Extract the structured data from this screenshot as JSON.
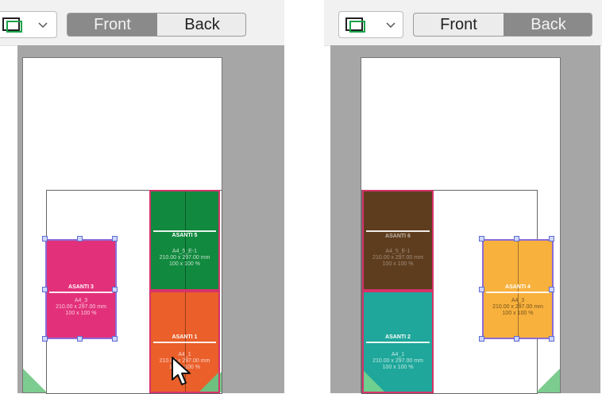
{
  "left": {
    "tabs": {
      "front": "Front",
      "back": "Back",
      "active": "front"
    },
    "blocks": [
      {
        "name": "ASANTI 3",
        "info1": "A4_3",
        "info2": "210.00 x 297.00 mm",
        "info3": "100 x 100 %",
        "color": "#e3307a"
      },
      {
        "name": "ASANTI 5",
        "info1": "A4_5_E-1",
        "info2": "210.00 x 297.00 mm",
        "info3": "100 x 100 %",
        "color": "#11893e"
      },
      {
        "name": "ASANTI 1",
        "info1": "A4_1",
        "info2": "210.00 x 297.00 mm",
        "info3": "100 x 100 %",
        "color": "#ea5f2a"
      }
    ]
  },
  "right": {
    "tabs": {
      "front": "Front",
      "back": "Back",
      "active": "back"
    },
    "blocks": [
      {
        "name": "ASANTI 6",
        "info1": "A4_5_E-1",
        "info2": "210.00 x 297.00 mm",
        "info3": "100 x 100 %",
        "color": "#5e3d1e"
      },
      {
        "name": "ASANTI 2",
        "info1": "A4_1",
        "info2": "210.00 x 297.00 mm",
        "info3": "100 x 100 %",
        "color": "#1ea79a"
      },
      {
        "name": "ASANTI 4",
        "info1": "A4_3",
        "info2": "210.00 x 297.00 mm",
        "info3": "100 x 100 %",
        "color": "#f8b13d"
      }
    ]
  }
}
